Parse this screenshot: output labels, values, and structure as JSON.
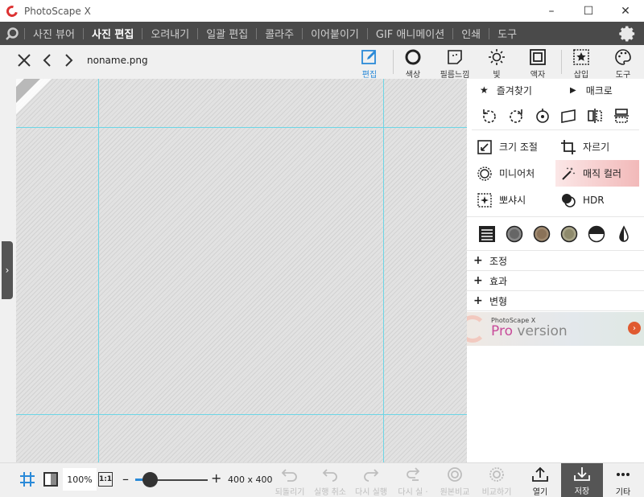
{
  "app": {
    "title": "PhotoScape X"
  },
  "window": {
    "minimize": "–",
    "maximize": "☐",
    "close": "✕"
  },
  "nav": {
    "items": [
      {
        "label": "사진 뷰어",
        "active": false
      },
      {
        "label": "사진 편집",
        "active": true
      },
      {
        "label": "오려내기",
        "active": false
      },
      {
        "label": "일괄 편집",
        "active": false
      },
      {
        "label": "콜라주",
        "active": false
      },
      {
        "label": "이어붙이기",
        "active": false
      },
      {
        "label": "GIF 애니메이션",
        "active": false
      },
      {
        "label": "인쇄",
        "active": false
      },
      {
        "label": "도구",
        "active": false
      }
    ]
  },
  "toolbar": {
    "filename": "noname.png",
    "tools": [
      {
        "label": "편집",
        "icon": "edit-icon"
      },
      {
        "label": "색상",
        "icon": "color-icon"
      },
      {
        "label": "필름느낌",
        "icon": "film-icon"
      },
      {
        "label": "빛",
        "icon": "light-icon"
      },
      {
        "label": "액자",
        "icon": "frame-icon"
      },
      {
        "label": "삽입",
        "icon": "insert-icon"
      },
      {
        "label": "도구",
        "icon": "tools-icon"
      }
    ]
  },
  "canvas": {
    "badge": "PRO Version"
  },
  "panel": {
    "favorites": "즐겨찾기",
    "macro": "매크로",
    "tools": {
      "resize": "크기 조절",
      "crop": "자르기",
      "miniature": "미니어처",
      "magic_color": "매직 컬러",
      "bloom": "뽀샤시",
      "hdr": "HDR"
    },
    "sections": [
      "조정",
      "효과",
      "변형"
    ],
    "pro_banner": {
      "small": "PhotoScape X",
      "pro": "Pro",
      "version": " version"
    }
  },
  "bottom": {
    "zoom": "100%",
    "one_to_one": "1:1",
    "zoom_level": 0.2,
    "size": "400 x 400",
    "actions": {
      "redo_all": "되돌리기",
      "undo": "실행 취소",
      "redo": "다시 실행",
      "redo_more": "다시 실 ·",
      "original_compare": "원본비교",
      "compare": "비교하기",
      "open": "열기",
      "save": "저장",
      "more": "기타"
    }
  }
}
